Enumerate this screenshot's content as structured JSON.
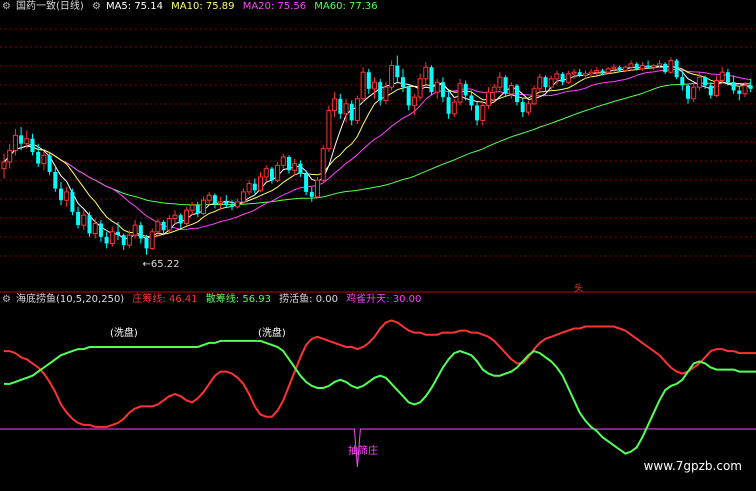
{
  "main_panel": {
    "title": "国药一致(日线)",
    "ma": [
      {
        "label": "MA5: 75.14",
        "color": "#ffffff"
      },
      {
        "label": "MA10: 75.89",
        "color": "#ffff66"
      },
      {
        "label": "MA20: 75.56",
        "color": "#ff44ff"
      },
      {
        "label": "MA60: 77.36",
        "color": "#55ff55"
      }
    ]
  },
  "sub_panel": {
    "title": "海底捞鱼(10,5,20,250)",
    "items": [
      {
        "label": "庄筹线: 46.41",
        "color": "#ff3333"
      },
      {
        "label": "散筹线: 56.93",
        "color": "#55ff55"
      },
      {
        "label": "捞活鱼: 0.00",
        "color": "#dddddd"
      },
      {
        "label": "鸡雀升天: 30.00",
        "color": "#ff44ff"
      }
    ]
  },
  "colors": {
    "up": "#ff3333",
    "down": "#00ffff",
    "green": "#55ff55",
    "purple": "#ff44ff",
    "grid": "#8a0000"
  },
  "watermark": "www.7gpzb.com",
  "chart_data": [
    {
      "type": "candlestick",
      "annotations": [
        {
          "text": "←65.22",
          "x": 25,
          "y": 65.22
        }
      ],
      "candles": [
        [
          70.4,
          71.3,
          69.8,
          70.8
        ],
        [
          70.8,
          71.9,
          70.4,
          71.5
        ],
        [
          71.5,
          72.8,
          71.2,
          72.4
        ],
        [
          72.4,
          72.9,
          71.5,
          71.9
        ],
        [
          71.9,
          72.7,
          71.6,
          72.2
        ],
        [
          72.2,
          72.5,
          71.2,
          71.4
        ],
        [
          71.4,
          71.9,
          70.5,
          70.7
        ],
        [
          70.7,
          71.4,
          70.3,
          71.2
        ],
        [
          71.2,
          71.4,
          70.0,
          70.2
        ],
        [
          70.2,
          70.6,
          69.0,
          69.2
        ],
        [
          69.2,
          69.6,
          68.2,
          68.5
        ],
        [
          68.5,
          69.3,
          68.1,
          69.0
        ],
        [
          69.0,
          69.2,
          67.6,
          67.8
        ],
        [
          67.8,
          68.1,
          66.8,
          67.0
        ],
        [
          67.0,
          67.9,
          66.7,
          67.6
        ],
        [
          67.6,
          67.8,
          66.3,
          66.5
        ],
        [
          66.5,
          67.4,
          66.2,
          67.1
        ],
        [
          67.1,
          67.3,
          66.0,
          66.3
        ],
        [
          66.3,
          66.6,
          65.6,
          65.9
        ],
        [
          65.9,
          66.9,
          65.7,
          66.6
        ],
        [
          66.6,
          67.2,
          66.1,
          66.4
        ],
        [
          66.4,
          66.5,
          65.5,
          65.8
        ],
        [
          65.8,
          66.7,
          65.6,
          66.4
        ],
        [
          66.4,
          67.3,
          66.2,
          67.0
        ],
        [
          67.0,
          67.2,
          65.9,
          66.2
        ],
        [
          66.2,
          66.4,
          65.22,
          65.6
        ],
        [
          65.6,
          66.8,
          65.5,
          66.6
        ],
        [
          66.6,
          67.4,
          66.3,
          67.2
        ],
        [
          67.2,
          67.3,
          66.4,
          66.7
        ],
        [
          66.7,
          67.6,
          66.5,
          67.4
        ],
        [
          67.4,
          67.9,
          67.0,
          67.6
        ],
        [
          67.6,
          67.7,
          66.8,
          67.1
        ],
        [
          67.1,
          68.1,
          67.0,
          67.9
        ],
        [
          67.9,
          68.4,
          67.6,
          68.2
        ],
        [
          68.2,
          68.4,
          67.5,
          67.7
        ],
        [
          67.7,
          68.7,
          67.6,
          68.5
        ],
        [
          68.5,
          69.0,
          68.2,
          68.8
        ],
        [
          68.8,
          68.9,
          68.0,
          68.3
        ],
        [
          68.3,
          68.7,
          67.9,
          68.4
        ],
        [
          68.4,
          68.8,
          68.1,
          68.2
        ],
        [
          68.2,
          68.5,
          67.9,
          68.1
        ],
        [
          68.1,
          68.6,
          68.0,
          68.4
        ],
        [
          68.4,
          69.2,
          68.3,
          69.0
        ],
        [
          69.0,
          69.7,
          68.8,
          69.5
        ],
        [
          69.5,
          69.8,
          68.9,
          69.1
        ],
        [
          69.1,
          70.2,
          69.0,
          69.9
        ],
        [
          69.9,
          70.6,
          69.6,
          70.4
        ],
        [
          70.4,
          70.5,
          69.5,
          69.7
        ],
        [
          69.7,
          70.8,
          69.6,
          70.6
        ],
        [
          70.6,
          71.3,
          70.4,
          71.1
        ],
        [
          71.1,
          71.2,
          70.1,
          70.3
        ],
        [
          70.3,
          71.0,
          70.0,
          70.7
        ],
        [
          70.7,
          70.9,
          69.9,
          70.1
        ],
        [
          70.1,
          70.3,
          68.8,
          69.0
        ],
        [
          69.0,
          69.3,
          68.4,
          68.7
        ],
        [
          68.7,
          69.9,
          68.6,
          69.7
        ],
        [
          69.7,
          71.8,
          69.6,
          71.6
        ],
        [
          71.6,
          74.2,
          71.4,
          73.9
        ],
        [
          73.9,
          75.0,
          73.5,
          74.6
        ],
        [
          74.6,
          74.9,
          73.4,
          73.7
        ],
        [
          73.7,
          74.6,
          73.2,
          74.3
        ],
        [
          74.3,
          74.5,
          73.0,
          73.3
        ],
        [
          73.3,
          74.8,
          73.1,
          74.6
        ],
        [
          74.6,
          76.5,
          74.4,
          76.2
        ],
        [
          76.2,
          76.4,
          74.9,
          75.2
        ],
        [
          75.2,
          75.9,
          74.6,
          75.6
        ],
        [
          75.6,
          75.8,
          74.2,
          74.5
        ],
        [
          74.5,
          75.6,
          74.3,
          75.3
        ],
        [
          75.3,
          76.9,
          75.1,
          76.6
        ],
        [
          76.6,
          77.2,
          75.6,
          75.9
        ],
        [
          75.9,
          76.4,
          75.0,
          75.3
        ],
        [
          75.3,
          75.4,
          73.9,
          74.2
        ],
        [
          74.2,
          74.9,
          73.6,
          74.7
        ],
        [
          74.7,
          76.1,
          74.5,
          75.8
        ],
        [
          75.8,
          76.8,
          75.5,
          76.5
        ],
        [
          76.5,
          76.6,
          74.8,
          75.0
        ],
        [
          75.0,
          75.8,
          74.6,
          75.6
        ],
        [
          75.6,
          75.9,
          74.4,
          74.7
        ],
        [
          74.7,
          75.0,
          73.4,
          73.7
        ],
        [
          73.7,
          74.6,
          73.5,
          74.4
        ],
        [
          74.4,
          75.8,
          74.2,
          75.5
        ],
        [
          75.5,
          75.7,
          74.5,
          74.8
        ],
        [
          74.8,
          75.1,
          73.9,
          74.2
        ],
        [
          74.2,
          74.4,
          73.0,
          73.3
        ],
        [
          73.3,
          74.4,
          73.0,
          74.2
        ],
        [
          74.2,
          75.3,
          74.0,
          75.0
        ],
        [
          75.0,
          75.5,
          74.4,
          75.3
        ],
        [
          75.3,
          76.2,
          75.1,
          75.9
        ],
        [
          75.9,
          76.0,
          74.7,
          74.9
        ],
        [
          74.9,
          75.6,
          74.6,
          75.4
        ],
        [
          75.4,
          75.5,
          74.2,
          74.4
        ],
        [
          74.4,
          74.6,
          73.5,
          73.8
        ],
        [
          73.8,
          74.5,
          73.6,
          74.3
        ],
        [
          74.3,
          75.4,
          74.2,
          75.2
        ],
        [
          75.2,
          76.1,
          75.0,
          75.9
        ],
        [
          75.9,
          76.0,
          75.0,
          75.3
        ],
        [
          75.3,
          76.0,
          75.1,
          75.8
        ],
        [
          75.8,
          76.3,
          75.4,
          76.1
        ],
        [
          76.1,
          76.2,
          75.4,
          75.6
        ],
        [
          75.6,
          76.3,
          75.5,
          76.1
        ],
        [
          76.1,
          76.4,
          75.8,
          76.2
        ],
        [
          76.2,
          76.4,
          75.9,
          76.0
        ],
        [
          76.0,
          76.3,
          75.8,
          76.1
        ],
        [
          76.1,
          76.4,
          75.9,
          76.2
        ],
        [
          76.2,
          76.5,
          76.0,
          76.3
        ],
        [
          76.3,
          76.4,
          76.0,
          76.2
        ],
        [
          76.2,
          76.5,
          76.1,
          76.4
        ],
        [
          76.4,
          76.7,
          76.2,
          76.5
        ],
        [
          76.5,
          76.6,
          76.2,
          76.3
        ],
        [
          76.3,
          76.6,
          76.2,
          76.5
        ],
        [
          76.5,
          76.9,
          76.3,
          76.7
        ],
        [
          76.7,
          76.8,
          76.3,
          76.4
        ],
        [
          76.4,
          76.8,
          76.3,
          76.6
        ],
        [
          76.6,
          76.9,
          76.4,
          76.5
        ],
        [
          76.5,
          76.7,
          76.3,
          76.6
        ],
        [
          76.6,
          76.9,
          76.5,
          76.7
        ],
        [
          76.7,
          76.8,
          76.1,
          76.2
        ],
        [
          76.2,
          77.1,
          76.1,
          76.9
        ],
        [
          76.9,
          77.0,
          75.8,
          75.9
        ],
        [
          75.9,
          76.3,
          75.1,
          75.4
        ],
        [
          75.4,
          75.5,
          74.3,
          74.6
        ],
        [
          74.6,
          75.6,
          74.4,
          75.3
        ],
        [
          75.3,
          76.2,
          75.1,
          75.9
        ],
        [
          75.9,
          76.0,
          75.2,
          75.4
        ],
        [
          75.4,
          75.6,
          74.6,
          74.8
        ],
        [
          74.8,
          76.0,
          74.7,
          75.7
        ],
        [
          75.7,
          76.5,
          75.5,
          76.2
        ],
        [
          76.2,
          76.4,
          75.4,
          75.6
        ],
        [
          75.6,
          76.0,
          74.9,
          75.1
        ],
        [
          75.1,
          75.4,
          74.5,
          74.9
        ],
        [
          74.9,
          75.6,
          74.7,
          75.4
        ],
        [
          75.4,
          75.8,
          75.0,
          75.2
        ]
      ],
      "ylim": [
        63.1,
        79.7
      ]
    },
    {
      "type": "line",
      "series": [
        {
          "name": "庄筹线",
          "values": [
            38,
            38,
            37,
            35,
            34,
            32,
            30,
            27,
            23,
            18,
            12,
            8,
            5,
            3,
            2,
            2,
            1,
            1,
            1,
            2,
            3,
            5,
            8,
            10,
            11,
            11,
            11,
            12,
            14,
            16,
            17,
            16,
            14,
            13,
            15,
            18,
            22,
            26,
            28,
            28,
            27,
            25,
            22,
            17,
            11,
            7,
            6,
            6,
            9,
            14,
            21,
            28,
            35,
            41,
            44,
            45,
            44,
            43,
            42,
            41,
            40,
            40,
            39,
            40,
            42,
            45,
            49,
            52,
            53,
            52,
            50,
            48,
            47,
            47,
            46,
            46,
            46,
            47,
            47,
            47,
            48,
            48,
            47,
            47,
            46,
            45,
            43,
            40,
            37,
            34,
            32,
            32,
            35,
            39,
            42,
            44,
            45,
            46,
            47,
            48,
            49,
            49,
            50,
            50,
            50,
            50,
            50,
            50,
            49,
            48,
            46,
            44,
            42,
            40,
            38,
            36,
            33,
            30,
            28,
            27,
            28,
            30,
            32,
            35,
            38,
            39,
            39,
            38,
            38,
            37,
            37,
            37,
            37
          ]
        },
        {
          "name": "散筹线",
          "values": [
            22,
            22,
            23,
            24,
            25,
            26,
            28,
            30,
            32,
            34,
            36,
            37,
            38,
            39,
            39,
            40,
            40,
            40,
            40,
            40,
            40,
            40,
            40,
            40,
            40,
            40,
            40,
            40,
            40,
            40,
            40,
            40,
            40,
            40,
            40,
            41,
            42,
            42,
            43,
            43,
            43,
            43,
            43,
            43,
            43,
            43,
            42,
            41,
            40,
            38,
            34,
            30,
            26,
            23,
            21,
            20,
            20,
            21,
            23,
            24,
            23,
            21,
            20,
            21,
            23,
            25,
            26,
            25,
            22,
            19,
            16,
            13,
            12,
            13,
            16,
            20,
            25,
            30,
            34,
            37,
            38,
            37,
            36,
            33,
            29,
            27,
            26,
            26,
            27,
            28,
            30,
            33,
            36,
            38,
            37,
            35,
            33,
            30,
            26,
            20,
            14,
            8,
            4,
            1,
            -1,
            -4,
            -6,
            -8,
            -10,
            -12,
            -11,
            -9,
            -4,
            2,
            8,
            14,
            19,
            21,
            22,
            24,
            28,
            32,
            33,
            32,
            30,
            29,
            29,
            29,
            29,
            28,
            28,
            28,
            28
          ]
        }
      ],
      "hline": 0,
      "annotations": [
        "(洗盘)",
        "(洗盘)",
        "抽筛庄",
        "头"
      ],
      "ylim": [
        -20,
        60
      ]
    }
  ]
}
